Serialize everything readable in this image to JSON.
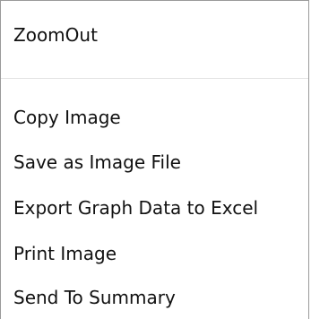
{
  "context_menu": {
    "items": [
      {
        "label": "ZoomOut"
      },
      {
        "label": "Copy Image"
      },
      {
        "label": "Save as Image File"
      },
      {
        "label": "Export Graph Data to Excel"
      },
      {
        "label": "Print Image"
      },
      {
        "label": "Send To Summary"
      }
    ]
  }
}
